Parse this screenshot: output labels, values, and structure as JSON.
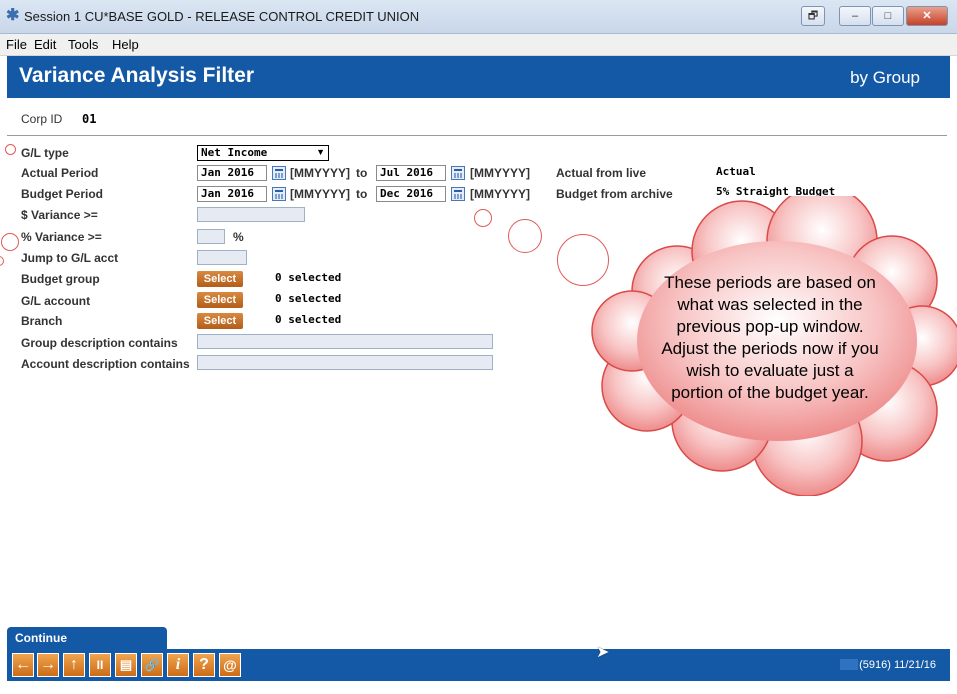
{
  "window": {
    "title": "Session 1 CU*BASE GOLD - RELEASE CONTROL CREDIT UNION",
    "buttons": [
      "🗗",
      "–",
      "□",
      "✕"
    ]
  },
  "menu": {
    "file": "File",
    "edit": "Edit",
    "tools": "Tools",
    "help": "Help"
  },
  "header": {
    "title": "Variance Analysis Filter",
    "subtitle": "by Group"
  },
  "corp": {
    "label": "Corp ID",
    "value": "01"
  },
  "form": {
    "gl_type_label": "G/L type",
    "gl_type_value": "Net Income",
    "actual_period_label": "Actual Period",
    "actual_from": "Jan 2016",
    "actual_to": "Jul 2016",
    "budget_period_label": "Budget Period",
    "budget_from": "Jan 2016",
    "budget_to": "Dec 2016",
    "date_format": "[MMYYYY]",
    "to_word": "to",
    "actual_from_live_label": "Actual from live",
    "actual_from_live_value": "Actual",
    "budget_from_archive_label": "Budget from archive",
    "budget_from_archive_value": "5% Straight Budget",
    "dollar_variance_label": "$ Variance >=",
    "percent_variance_label": "% Variance >=",
    "percent_sign": "%",
    "jump_label": "Jump to G/L acct",
    "budget_group_label": "Budget group",
    "gl_account_label": "G/L account",
    "branch_label": "Branch",
    "select_label": "Select",
    "selected_text": "0 selected",
    "group_desc_label": "Group description contains",
    "account_desc_label": "Account description contains"
  },
  "callout": {
    "lines": [
      "These periods are based on",
      "what was selected in the",
      "previous pop-up window.",
      "Adjust the periods now if you",
      "wish to evaluate just a",
      "portion of the budget year."
    ]
  },
  "footer": {
    "continue_label": "Continue",
    "status": "(5916) 11/21/16",
    "toolbar_icons": [
      "arrow-left-icon",
      "arrow-right-icon",
      "arrow-up-icon",
      "pause-icon",
      "print-icon",
      "link-icon",
      "info-icon",
      "help-icon",
      "at-icon"
    ],
    "toolbar_glyphs": [
      "←",
      "→",
      "↑",
      "II",
      "▤",
      "🔗",
      "i",
      "?",
      "@"
    ]
  },
  "colors": {
    "header_blue": "#1459a6",
    "select_button": "#c46f27",
    "marker_red": "#e15b57",
    "cloud_fill": "#f6a3a3"
  }
}
